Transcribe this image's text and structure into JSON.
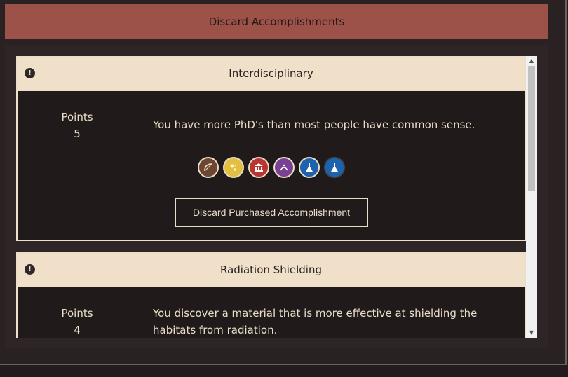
{
  "dialog": {
    "title": "Discard Accomplishments"
  },
  "cards": [
    {
      "title": "Interdisciplinary",
      "alert_icon": "!",
      "points_label": "Points",
      "points_value": "5",
      "description": "You have more PhD's than most people have common sense.",
      "badges": [
        {
          "icon": "bow-icon",
          "color": "#6d4632"
        },
        {
          "icon": "sun-icon",
          "color": "#e2bf41"
        },
        {
          "icon": "temple-icon",
          "color": "#b73631"
        },
        {
          "icon": "face-icon",
          "color": "#7a4094"
        },
        {
          "icon": "flask-icon",
          "color": "#1d62ad"
        },
        {
          "icon": "flask-icon",
          "color": "#1d62ad"
        }
      ],
      "button_label": "Discard Purchased Accomplishment"
    },
    {
      "title": "Radiation Shielding",
      "alert_icon": "!",
      "points_label": "Points",
      "points_value": "4",
      "description": "You discover a material that is more effective at shielding the habitats from radiation."
    }
  ],
  "colors": {
    "header": "#9c5248",
    "card_head": "#f1e0c9",
    "background": "#231c1c"
  }
}
